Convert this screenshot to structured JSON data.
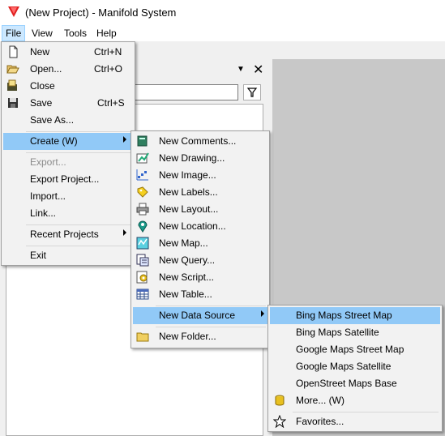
{
  "window": {
    "title": "(New Project) - Manifold System"
  },
  "menubar": [
    {
      "id": "file",
      "label": "File",
      "active": true
    },
    {
      "id": "view",
      "label": "View"
    },
    {
      "id": "tools",
      "label": "Tools"
    },
    {
      "id": "help",
      "label": "Help"
    }
  ],
  "file_menu": {
    "new": {
      "label": "New",
      "shortcut": "Ctrl+N",
      "icon": "new-document-icon"
    },
    "open": {
      "label": "Open...",
      "shortcut": "Ctrl+O",
      "icon": "open-folder-icon"
    },
    "close": {
      "label": "Close",
      "icon": "close-folder-icon"
    },
    "save": {
      "label": "Save",
      "shortcut": "Ctrl+S",
      "icon": "floppy-disk-icon"
    },
    "save_as": {
      "label": "Save As..."
    },
    "create": {
      "label": "Create (W)"
    },
    "export": {
      "label": "Export..."
    },
    "export_project": {
      "label": "Export Project..."
    },
    "import": {
      "label": "Import..."
    },
    "link": {
      "label": "Link..."
    },
    "recent": {
      "label": "Recent Projects"
    },
    "exit": {
      "label": "Exit"
    }
  },
  "create_menu": {
    "comments": {
      "label": "New Comments...",
      "icon": "comments-book-icon"
    },
    "drawing": {
      "label": "New Drawing...",
      "icon": "drawing-icon"
    },
    "image": {
      "label": "New Image...",
      "icon": "image-icon"
    },
    "labels": {
      "label": "New Labels...",
      "icon": "label-tag-icon"
    },
    "layout": {
      "label": "New Layout...",
      "icon": "printer-layout-icon"
    },
    "location": {
      "label": "New Location...",
      "icon": "map-pin-icon"
    },
    "map": {
      "label": "New Map...",
      "icon": "map-icon"
    },
    "query": {
      "label": "New Query...",
      "icon": "query-icon"
    },
    "script": {
      "label": "New Script...",
      "icon": "script-gear-icon"
    },
    "table": {
      "label": "New Table...",
      "icon": "table-grid-icon"
    },
    "data_source": {
      "label": "New Data Source"
    },
    "folder": {
      "label": "New Folder...",
      "icon": "folder-icon"
    }
  },
  "datasource_menu": {
    "bing_street": {
      "label": "Bing Maps Street Map"
    },
    "bing_satellite": {
      "label": "Bing Maps Satellite"
    },
    "google_street": {
      "label": "Google Maps Street Map"
    },
    "google_satellite": {
      "label": "Google Maps Satellite"
    },
    "osm_base": {
      "label": "OpenStreet Maps Base"
    },
    "more": {
      "label": "More... (W)",
      "icon": "database-icon"
    },
    "favorites": {
      "label": "Favorites...",
      "icon": "star-icon"
    }
  },
  "pane": {
    "dropdown_icon": "dropdown-arrow-icon",
    "close_icon": "close-icon",
    "filter_icon": "filter-funnel-icon"
  },
  "colors": {
    "highlight": "#91c9f7",
    "menubar_active": "#cce8ff",
    "app_icon_red": "#e02020"
  }
}
